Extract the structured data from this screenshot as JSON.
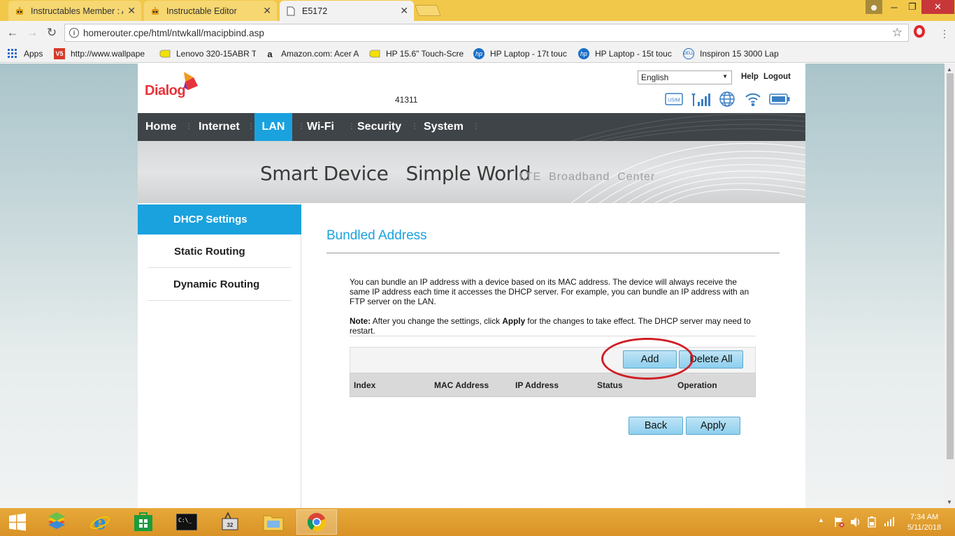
{
  "browser": {
    "tabs": [
      {
        "title": "Instructables Member : A",
        "icon": "instructables-robot-icon",
        "active": false
      },
      {
        "title": "Instructable Editor",
        "icon": "instructables-robot-icon",
        "active": false
      },
      {
        "title": "E5172",
        "icon": "page-icon",
        "active": true
      }
    ],
    "url": "homerouter.cpe/html/ntwkall/macipbind.asp",
    "bookmarks": [
      {
        "label": "Apps",
        "icon": "apps-grid-icon"
      },
      {
        "label": "http://www.wallpape",
        "icon": "v5-icon"
      },
      {
        "label": "Lenovo 320-15ABR T",
        "icon": "tag-icon"
      },
      {
        "label": "Amazon.com: Acer A",
        "icon": "amazon-icon"
      },
      {
        "label": "HP 15.6\" Touch-Scre",
        "icon": "tag-icon"
      },
      {
        "label": "HP Laptop - 17t touc",
        "icon": "hp-icon"
      },
      {
        "label": "HP Laptop - 15t touc",
        "icon": "hp-icon"
      },
      {
        "label": "Inspiron 15 3000 Lap",
        "icon": "dell-icon"
      }
    ]
  },
  "router": {
    "logo": "Dialog",
    "device_id": "41311",
    "language": "English",
    "help": "Help",
    "logout": "Logout",
    "nav": [
      {
        "label": "Home",
        "active": false
      },
      {
        "label": "Internet",
        "active": false
      },
      {
        "label": "LAN",
        "active": true
      },
      {
        "label": "Wi-Fi",
        "active": false
      },
      {
        "label": "Security",
        "active": false
      },
      {
        "label": "System",
        "active": false
      }
    ],
    "banner": {
      "slogan": "Smart Device   Simple World",
      "tagline": "LTE  Broadband  Center"
    },
    "sidebar": [
      {
        "label": "DHCP Settings",
        "active": true
      },
      {
        "label": "Static Routing",
        "active": false
      },
      {
        "label": "Dynamic Routing",
        "active": false
      }
    ],
    "content": {
      "title": "Bundled Address",
      "description": "You can bundle an IP address with a device based on its MAC address. The device will always receive the same IP address each time it accesses the DHCP server. For example, you can bundle an IP address with an FTP server on the LAN.",
      "note_label": "Note:",
      "note_part1": " After you change the settings, click ",
      "note_apply_word": "Apply",
      "note_part2": " for the changes to take effect. The DHCP server may need to restart.",
      "buttons": {
        "add": "Add",
        "delete_all": "Delete All",
        "back": "Back",
        "apply": "Apply"
      },
      "table_headers": [
        "Index",
        "MAC Address",
        "IP Address",
        "Status",
        "Operation"
      ]
    },
    "accent_color": "#1aa2de",
    "nav_bg_color": "#3f4448"
  },
  "taskbar": {
    "time": "7:34 AM",
    "date": "5/11/2018"
  }
}
